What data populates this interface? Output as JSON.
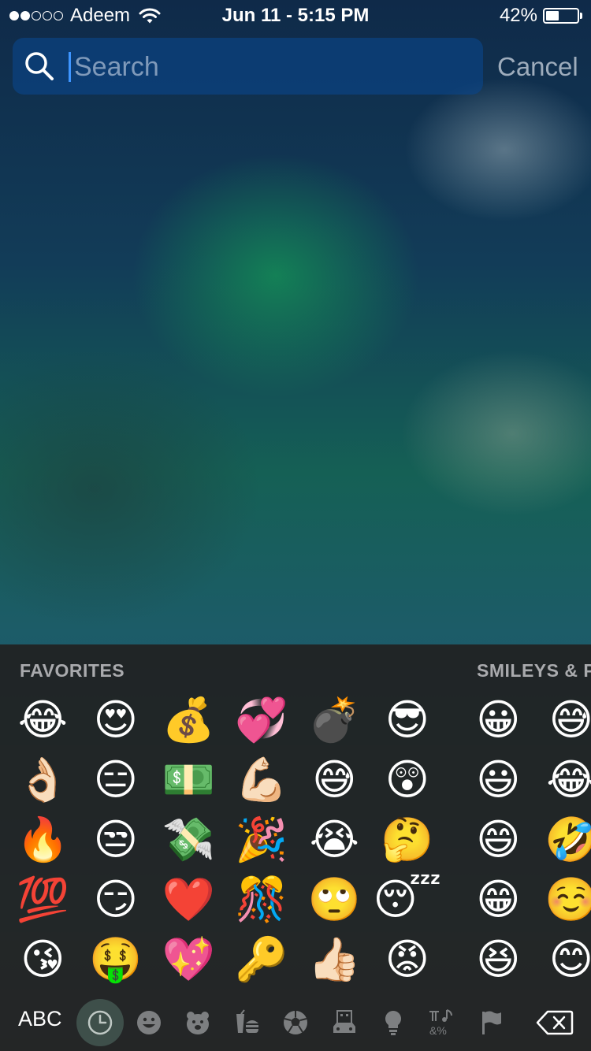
{
  "status_bar": {
    "carrier": "Adeem",
    "time": "Jun 11 - 5:15 PM",
    "battery_percent": "42%",
    "battery_level": 0.42,
    "signal_strength": 2,
    "signal_max": 5
  },
  "search": {
    "placeholder": "Search",
    "value": "",
    "cancel_label": "Cancel"
  },
  "keyboard": {
    "sections": {
      "favorites": "FAVORITES",
      "smileys": "SMILEYS & P"
    },
    "favorites": [
      "😂",
      "👌🏻",
      "🔥",
      "💯",
      "😘",
      "😍",
      "😑",
      "😒",
      "😏",
      "🤑",
      "💰",
      "💵",
      "💸",
      "❤️",
      "💖",
      "💞",
      "💪🏻",
      "🎉",
      "🎊",
      "🔑",
      "💣",
      "😅",
      "😭",
      "🙄",
      "👍🏻",
      "😎",
      "😲",
      "🤔",
      "😴",
      "😡"
    ],
    "smileys": [
      "😀",
      "😃",
      "😄",
      "😁",
      "😆",
      "😅",
      "😂",
      "🤣",
      "☺️",
      "😊"
    ],
    "abc_label": "ABC",
    "categories": [
      "clock-icon",
      "smiley-icon",
      "bear-icon",
      "food-icon",
      "ball-icon",
      "building-icon",
      "lightbulb-icon",
      "symbols-icon",
      "flag-icon"
    ],
    "active_category": "clock-icon"
  },
  "colors": {
    "search_bar": "#0a468c",
    "caret": "#3e95ff",
    "keyboard_bg": "#202121",
    "section_title": "#a9aaad",
    "category_icon": "#7d7f81",
    "active_category_bg": "#3e4f4a"
  }
}
